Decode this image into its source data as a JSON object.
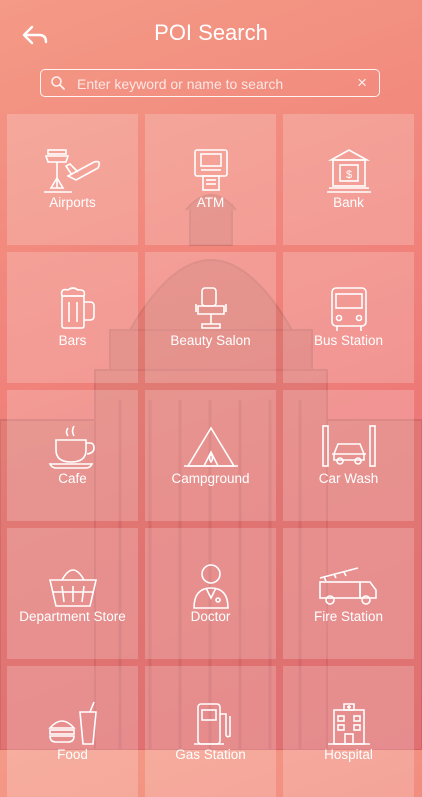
{
  "header": {
    "title": "POI Search",
    "back_icon": "back-arrow-icon"
  },
  "search": {
    "placeholder": "Enter keyword or name to search",
    "value": "",
    "clear_symbol": "×"
  },
  "categories": [
    {
      "label": "Airports",
      "icon": "airport-icon"
    },
    {
      "label": "ATM",
      "icon": "atm-icon"
    },
    {
      "label": "Bank",
      "icon": "bank-icon"
    },
    {
      "label": "Bars",
      "icon": "beer-mug-icon"
    },
    {
      "label": "Beauty Salon",
      "icon": "salon-chair-icon"
    },
    {
      "label": "Bus Station",
      "icon": "bus-icon"
    },
    {
      "label": "Cafe",
      "icon": "coffee-cup-icon"
    },
    {
      "label": "Campground",
      "icon": "tent-icon"
    },
    {
      "label": "Car Wash",
      "icon": "car-wash-icon"
    },
    {
      "label": "Department Store",
      "icon": "shopping-basket-icon"
    },
    {
      "label": "Doctor",
      "icon": "doctor-icon"
    },
    {
      "label": "Fire Station",
      "icon": "fire-truck-icon"
    },
    {
      "label": "Food",
      "icon": "fast-food-icon"
    },
    {
      "label": "Gas Station",
      "icon": "fuel-pump-icon"
    },
    {
      "label": "Hospital",
      "icon": "hospital-icon"
    }
  ]
}
